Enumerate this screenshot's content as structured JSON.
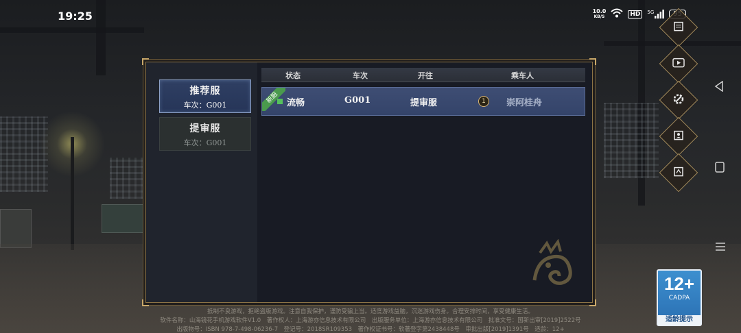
{
  "status_bar": {
    "time": "19:25",
    "net_speed_value": "10.0",
    "net_speed_unit": "KB/S",
    "hd_label": "HD",
    "signal_label": "5G",
    "battery": "95"
  },
  "sidebar": {
    "tabs": [
      {
        "title": "推荐服",
        "sub": "车次：G001"
      },
      {
        "title": "提审服",
        "sub": "车次：G001"
      }
    ]
  },
  "table": {
    "headers": {
      "status": "状态",
      "train": "车次",
      "destination": "开往",
      "passenger": "乘车人"
    },
    "rows": [
      {
        "tag": "新服",
        "status": "流畅",
        "train": "G001",
        "destination": "提审服",
        "rank": "1",
        "passenger": "崇阿桂舟"
      }
    ]
  },
  "age_rating": {
    "number": "12+",
    "org": "CADPA",
    "label": "适龄提示"
  },
  "footer": {
    "line1": "抵制不良游戏，拒绝盗版游戏。注意自我保护，谨防受骗上当。适度游戏益脑，沉迷游戏伤身。合理安排时间，享受健康生活。",
    "line2": "软件名称：山海镜花手机游戏软件V1.0　著作权人：上海游亦信息技术有限公司　出版服务单位：上海游亦信息技术有限公司　批准文号：国新出审[2019]2522号",
    "line3": "出版物号：ISBN 978-7-498-06236-7　登记号：2018SR109353　著作权证书号：软著登字第2438448号　审批出版[2019]1391号　适龄：12+"
  },
  "colors": {
    "panel_border": "#8b7346",
    "active_tab": "#2f3f63",
    "status_ok": "#55c15d",
    "new_tag": "#4a9a4d"
  }
}
